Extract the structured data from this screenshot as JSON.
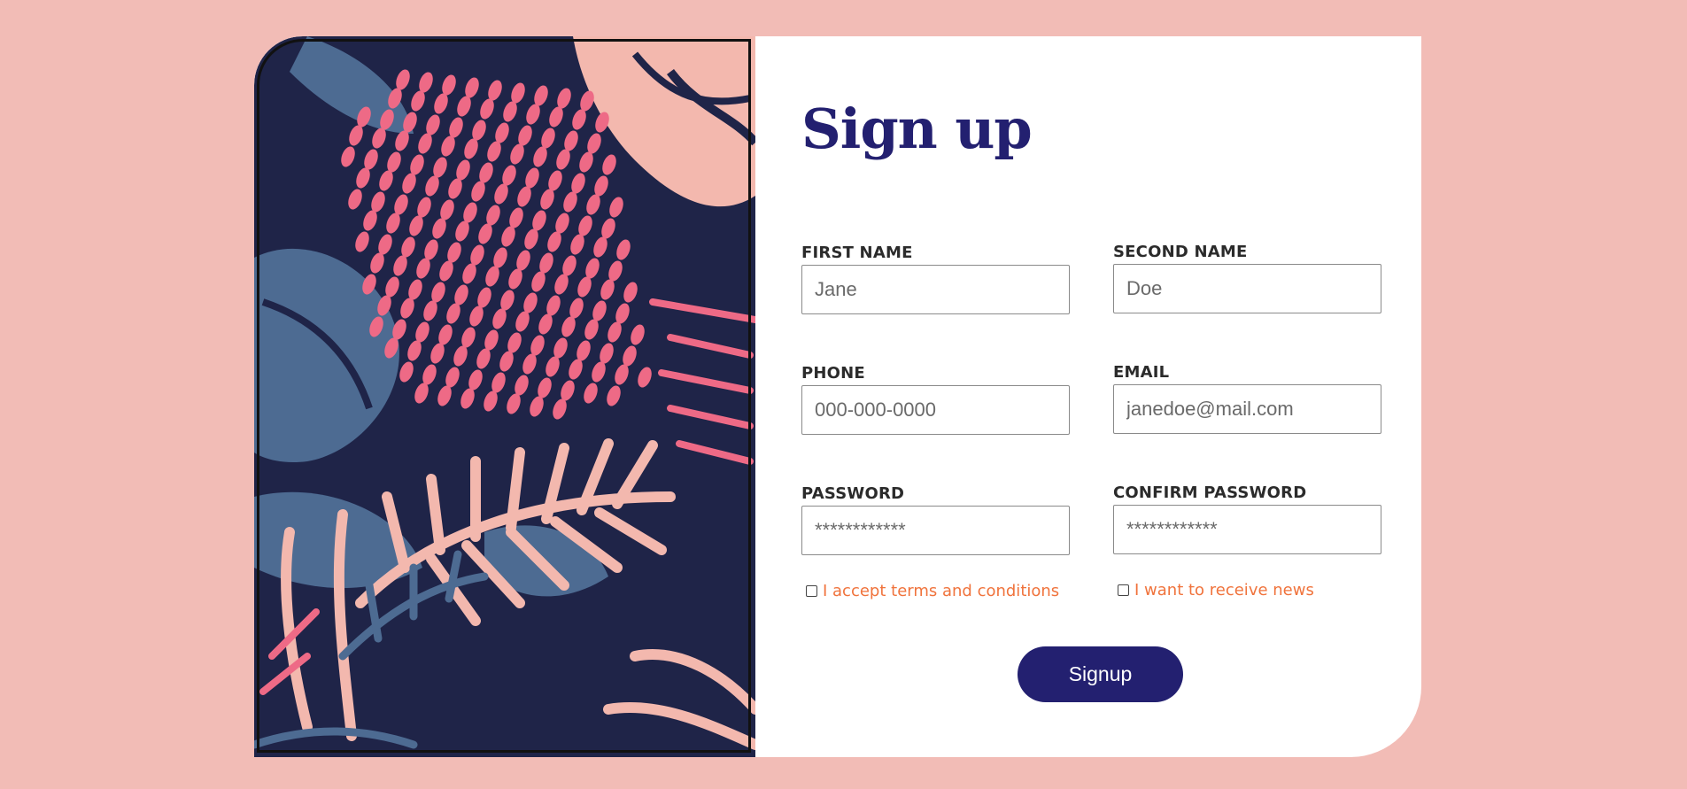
{
  "form": {
    "title": "Sign up",
    "first_name": {
      "label": "FIRST NAME",
      "placeholder": "Jane"
    },
    "second_name": {
      "label": "SECOND NAME",
      "placeholder": "Doe"
    },
    "phone": {
      "label": "PHONE",
      "placeholder": "000-000-0000"
    },
    "email": {
      "label": "EMAIL",
      "placeholder": "janedoe@mail.com"
    },
    "password": {
      "label": "PASSWORD",
      "placeholder": "************"
    },
    "confirm_password": {
      "label": "CONFIRM PASSWORD",
      "placeholder": "************"
    },
    "terms_label": "I accept terms and conditions",
    "news_label": "I want to receive news",
    "submit_label": "Signup"
  },
  "colors": {
    "background": "#f2bcb6",
    "card": "#ffffff",
    "title": "#232070",
    "button": "#232070",
    "checkbox_text": "#f0733c",
    "art_navy": "#1f2448",
    "art_slate": "#4d6b92",
    "art_pink": "#ee6a86",
    "art_blush": "#f3b8ae"
  },
  "illustration": {
    "name": "tropical-leaves-illustration"
  }
}
